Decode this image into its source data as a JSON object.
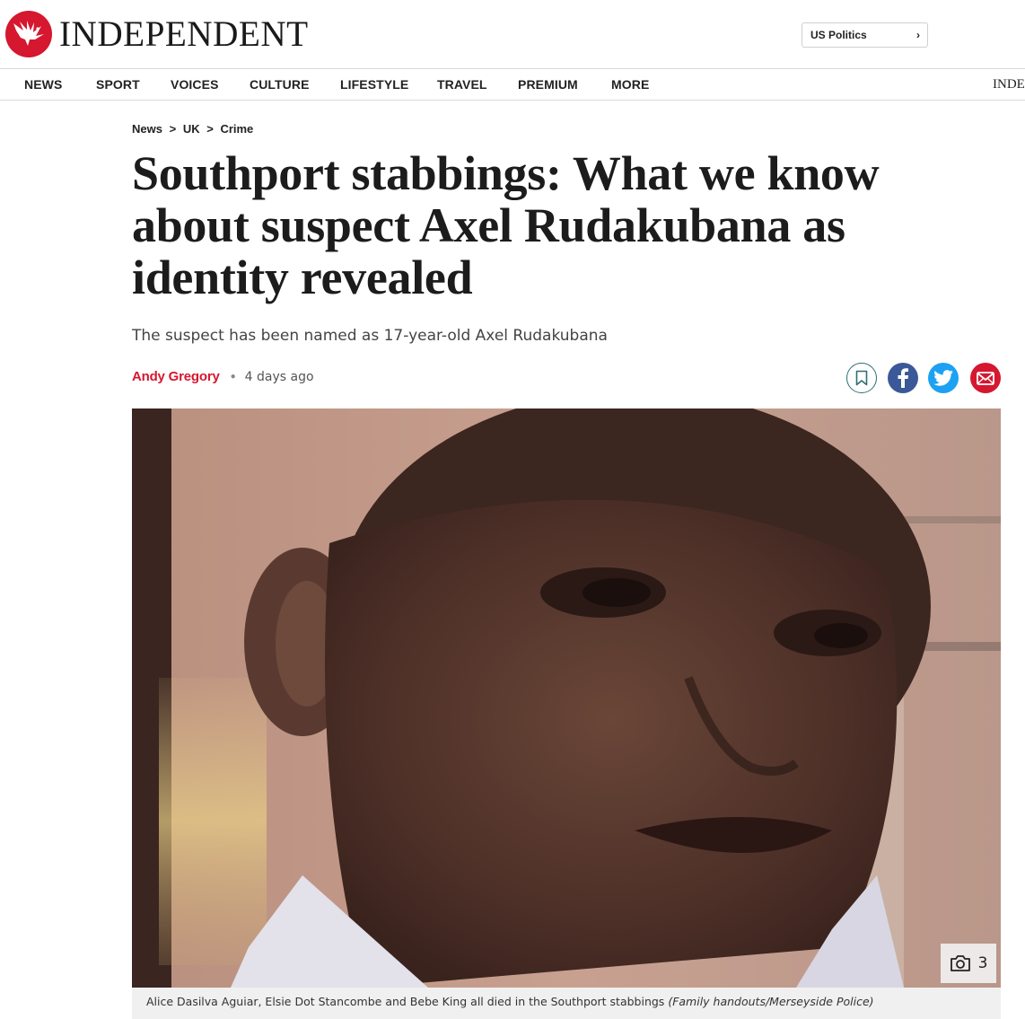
{
  "brand": {
    "name": "INDEPENDENT",
    "accent": "#d5172f"
  },
  "header": {
    "us_politics_label": "US Politics"
  },
  "nav": {
    "items": [
      "NEWS",
      "SPORT",
      "VOICES",
      "CULTURE",
      "LIFESTYLE",
      "TRAVEL",
      "PREMIUM",
      "MORE"
    ],
    "edge_text": "INDE"
  },
  "breadcrumb": {
    "items": [
      "News",
      "UK",
      "Crime"
    ],
    "separator": ">"
  },
  "article": {
    "headline": "Southport stabbings: What we know about suspect Axel Rudakubana as identity revealed",
    "standfirst": "The suspect has been named as 17-year-old Axel Rudakubana",
    "author": "Andy Gregory",
    "time": "4 days ago"
  },
  "share": {
    "icons": [
      "bookmark-icon",
      "facebook-icon",
      "twitter-icon",
      "email-icon"
    ]
  },
  "image": {
    "gallery_count": "3",
    "caption": "Alice Dasilva Aguiar, Elsie Dot Stancombe and Bebe King all died in the Southport stabbings",
    "credit": "(Family handouts/Merseyside Police)"
  }
}
